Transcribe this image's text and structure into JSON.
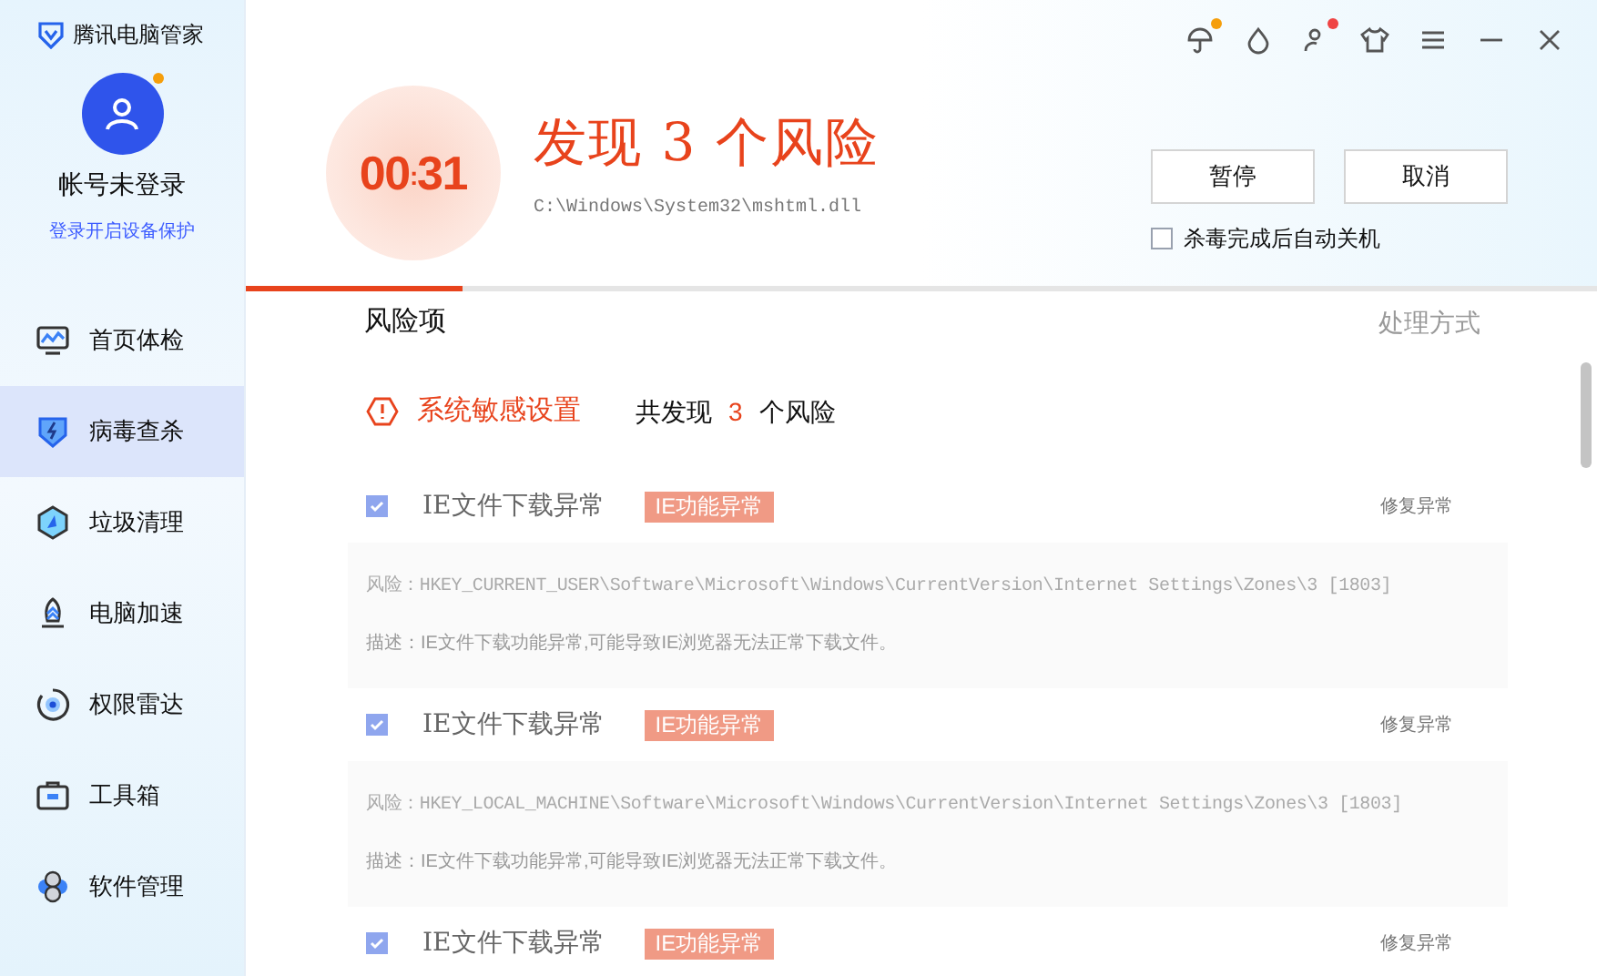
{
  "app": {
    "title": "腾讯电脑管家"
  },
  "account": {
    "name": "帐号未登录",
    "link": "登录开启设备保护",
    "notification": true
  },
  "sidebar": {
    "items": [
      {
        "label": "首页体检",
        "selected": false
      },
      {
        "label": "病毒查杀",
        "selected": true
      },
      {
        "label": "垃圾清理",
        "selected": false
      },
      {
        "label": "电脑加速",
        "selected": false
      },
      {
        "label": "权限雷达",
        "selected": false
      },
      {
        "label": "工具箱",
        "selected": false
      },
      {
        "label": "软件管理",
        "selected": false
      }
    ]
  },
  "toolbar": {
    "notification_dots": [
      {
        "color": "#f59e0b"
      },
      {
        "color": "#ef4444"
      }
    ]
  },
  "scan": {
    "timer_minutes": "00",
    "timer_separator": ":",
    "timer_seconds": "31",
    "title": "发现 3 个风险",
    "path": "C:\\Windows\\System32\\mshtml.dll",
    "buttons": [
      "暂停",
      "取消"
    ],
    "auto_shutdown": {
      "label": "杀毒完成后自动关机",
      "checked": false
    },
    "progress": {
      "level": 0.16
    }
  },
  "table": {
    "columns": [
      "风险项",
      "处理方式"
    ]
  },
  "group": {
    "title": "系统敏感设置",
    "summary_prefix": "共发现",
    "count": "3",
    "summary_suffix": "个风险"
  },
  "risks": [
    {
      "name": "IE文件下载异常",
      "tag": "IE功能异常",
      "action": "修复异常",
      "checked": true,
      "risk": "风险：HKEY_CURRENT_USER\\Software\\Microsoft\\Windows\\CurrentVersion\\Internet Settings\\Zones\\3 [1803]",
      "description": "描述：IE文件下载功能异常,可能导致IE浏览器无法正常下载文件。"
    },
    {
      "name": "IE文件下载异常",
      "tag": "IE功能异常",
      "action": "修复异常",
      "checked": true,
      "risk": "风险：HKEY_LOCAL_MACHINE\\Software\\Microsoft\\Windows\\CurrentVersion\\Internet Settings\\Zones\\3 [1803]",
      "description": "描述：IE文件下载功能异常,可能导致IE浏览器无法正常下载文件。"
    },
    {
      "name": "IE文件下载异常",
      "tag": "IE功能异常",
      "action": "修复异常",
      "checked": true
    }
  ]
}
